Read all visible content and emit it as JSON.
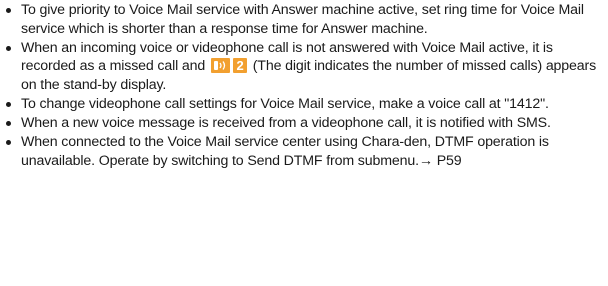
{
  "header_fragment": "",
  "notes": [
    "To give priority to Voice Mail service with Answer machine active, set ring time for Voice Mail service which is shorter than a response time for Answer machine.",
    "When an incoming voice or videophone call is not answered with Voice Mail active, it is recorded as a missed call and",
    "(The digit indicates the number of missed calls) appears on the stand-by display.",
    "To change videophone call settings for Voice Mail service, make a voice call at \"1412\".",
    "When a new voice message is received from a videophone call, it is notified with SMS.",
    "When connected to the Voice Mail service center using Chara-den, DTMF operation is unavailable. Operate by switching to Send DTMF from submenu.→ P59"
  ],
  "missed_call_icon": {
    "name": "missed-call-icon",
    "digit": "2",
    "colors": {
      "icon_box": "#f2a030",
      "digit_box": "#f2a030",
      "glyph": "#ffffff"
    }
  }
}
